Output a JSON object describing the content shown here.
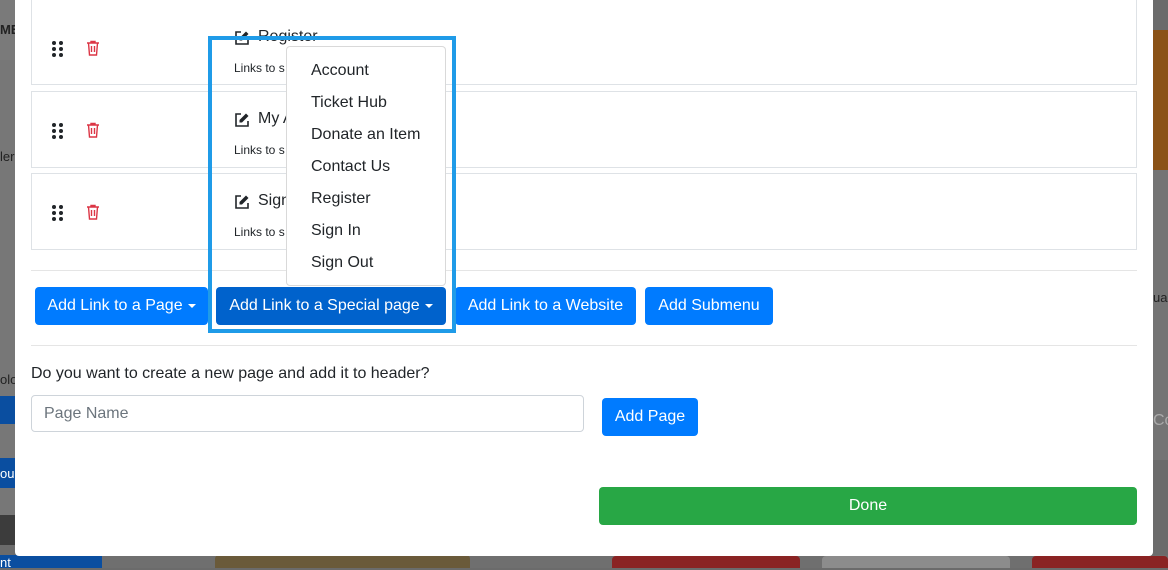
{
  "links": [
    {
      "title": "Register",
      "subtitle": "Links to s"
    },
    {
      "title": "My A",
      "subtitle": "Links to s"
    },
    {
      "title": "Sign",
      "subtitle": "Links to s"
    }
  ],
  "toolbar": {
    "add_page_link": "Add Link to a Page",
    "add_special_link": "Add Link to a Special page",
    "add_website_link": "Add Link to a Website",
    "add_submenu": "Add Submenu"
  },
  "special_menu": {
    "items": [
      "Account",
      "Ticket Hub",
      "Donate an Item",
      "Contact Us",
      "Register",
      "Sign In",
      "Sign Out"
    ]
  },
  "new_page": {
    "question": "Do you want to create a new page and add it to header?",
    "placeholder": "Page Name",
    "value": "",
    "add_button": "Add Page"
  },
  "done_label": "Done",
  "background_fragments": {
    "left_1": "ME",
    "left_2": "ler",
    "left_3": "olo",
    "left_4": "ou",
    "left_5": "nt",
    "right_1": "ua",
    "right_2": "Co"
  },
  "colors": {
    "primary": "#007bff",
    "primary_active": "#0062cc",
    "success": "#28a745",
    "danger": "#dc3545",
    "highlight": "#1f9be8"
  },
  "icons": {
    "drag": "drag-handle-icon",
    "delete": "trash-icon",
    "edit": "edit-icon",
    "caret": "caret-down-icon"
  }
}
